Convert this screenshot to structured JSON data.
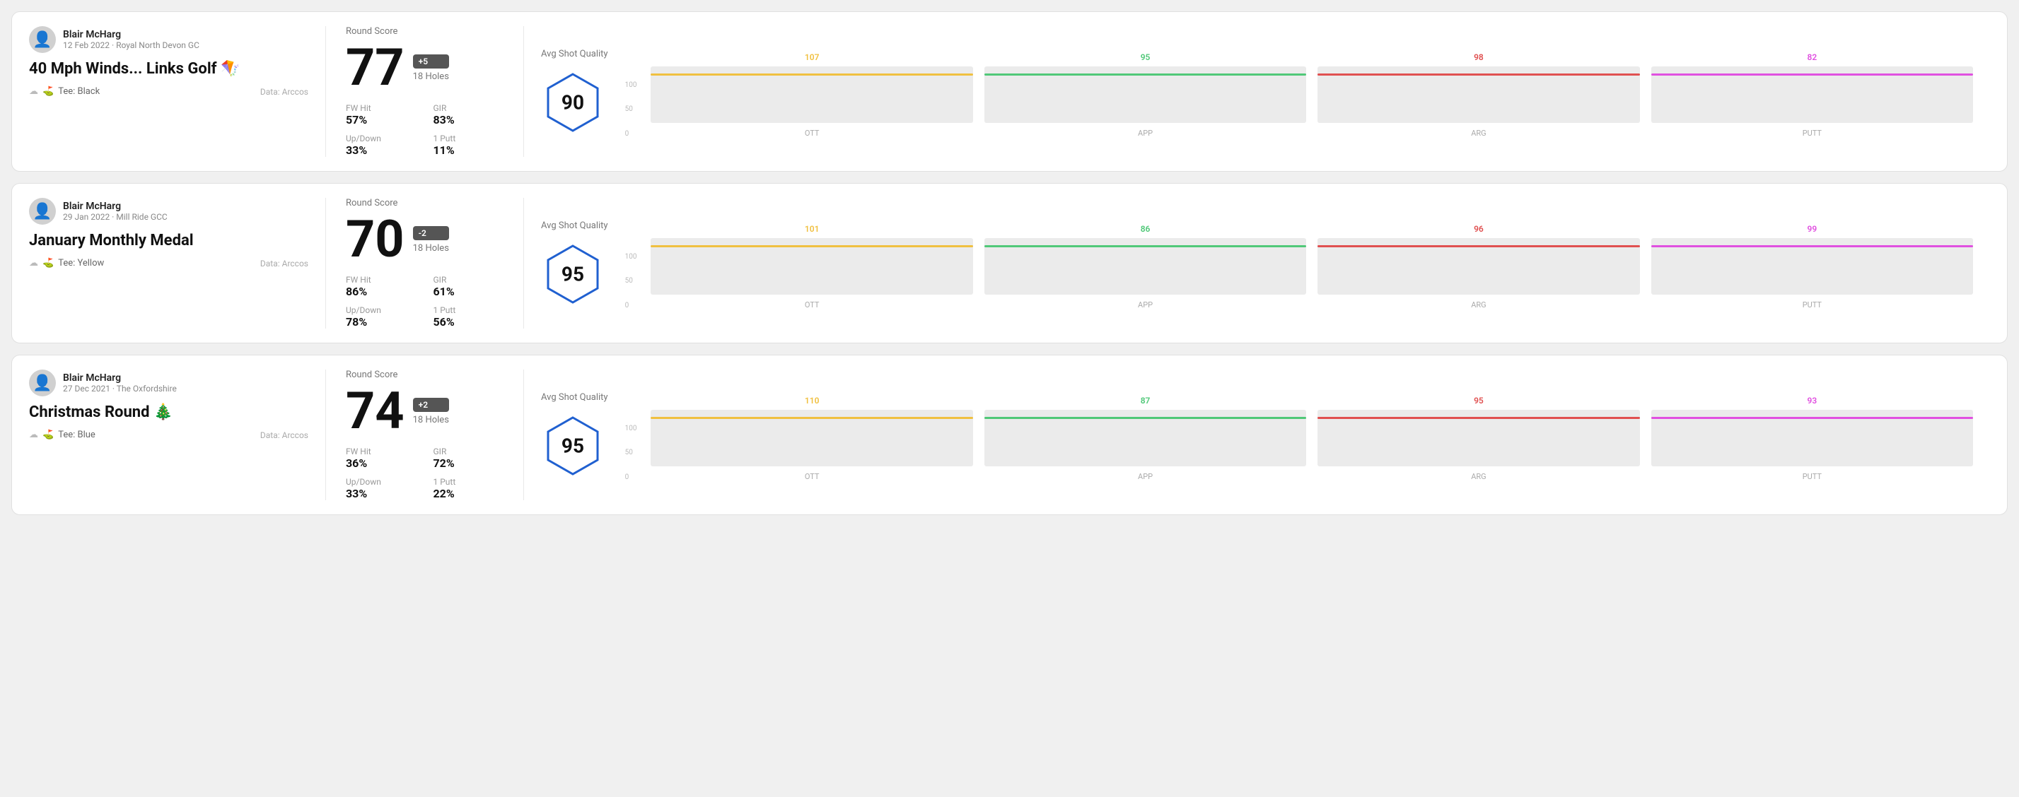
{
  "rounds": [
    {
      "id": "round-1",
      "user": {
        "name": "Blair McHarg",
        "date": "12 Feb 2022 · Royal North Devon GC"
      },
      "title": "40 Mph Winds... Links Golf 🪁",
      "tee": "Black",
      "data_source": "Data: Arccos",
      "score": {
        "label": "Round Score",
        "value": "77",
        "badge": "+5",
        "holes": "18 Holes"
      },
      "stats": [
        {
          "label": "FW Hit",
          "value": "57%"
        },
        {
          "label": "GIR",
          "value": "83%"
        },
        {
          "label": "Up/Down",
          "value": "33%"
        },
        {
          "label": "1 Putt",
          "value": "11%"
        }
      ],
      "shot_quality": {
        "label": "Avg Shot Quality",
        "score": "90"
      },
      "chart": {
        "bars": [
          {
            "label": "OTT",
            "value": 107,
            "color": "#f0c040",
            "max": 100
          },
          {
            "label": "APP",
            "value": 95,
            "color": "#50c878",
            "max": 100
          },
          {
            "label": "ARG",
            "value": 98,
            "color": "#e05050",
            "max": 100
          },
          {
            "label": "PUTT",
            "value": 82,
            "color": "#e050e0",
            "max": 100
          }
        ]
      }
    },
    {
      "id": "round-2",
      "user": {
        "name": "Blair McHarg",
        "date": "29 Jan 2022 · Mill Ride GCC"
      },
      "title": "January Monthly Medal",
      "tee": "Yellow",
      "data_source": "Data: Arccos",
      "score": {
        "label": "Round Score",
        "value": "70",
        "badge": "-2",
        "holes": "18 Holes"
      },
      "stats": [
        {
          "label": "FW Hit",
          "value": "86%"
        },
        {
          "label": "GIR",
          "value": "61%"
        },
        {
          "label": "Up/Down",
          "value": "78%"
        },
        {
          "label": "1 Putt",
          "value": "56%"
        }
      ],
      "shot_quality": {
        "label": "Avg Shot Quality",
        "score": "95"
      },
      "chart": {
        "bars": [
          {
            "label": "OTT",
            "value": 101,
            "color": "#f0c040",
            "max": 100
          },
          {
            "label": "APP",
            "value": 86,
            "color": "#50c878",
            "max": 100
          },
          {
            "label": "ARG",
            "value": 96,
            "color": "#e05050",
            "max": 100
          },
          {
            "label": "PUTT",
            "value": 99,
            "color": "#e050e0",
            "max": 100
          }
        ]
      }
    },
    {
      "id": "round-3",
      "user": {
        "name": "Blair McHarg",
        "date": "27 Dec 2021 · The Oxfordshire"
      },
      "title": "Christmas Round 🎄",
      "tee": "Blue",
      "data_source": "Data: Arccos",
      "score": {
        "label": "Round Score",
        "value": "74",
        "badge": "+2",
        "holes": "18 Holes"
      },
      "stats": [
        {
          "label": "FW Hit",
          "value": "36%"
        },
        {
          "label": "GIR",
          "value": "72%"
        },
        {
          "label": "Up/Down",
          "value": "33%"
        },
        {
          "label": "1 Putt",
          "value": "22%"
        }
      ],
      "shot_quality": {
        "label": "Avg Shot Quality",
        "score": "95"
      },
      "chart": {
        "bars": [
          {
            "label": "OTT",
            "value": 110,
            "color": "#f0c040",
            "max": 100
          },
          {
            "label": "APP",
            "value": 87,
            "color": "#50c878",
            "max": 100
          },
          {
            "label": "ARG",
            "value": 95,
            "color": "#e05050",
            "max": 100
          },
          {
            "label": "PUTT",
            "value": 93,
            "color": "#e050e0",
            "max": 100
          }
        ]
      }
    }
  ],
  "y_axis_labels": [
    "100",
    "50",
    "0"
  ]
}
